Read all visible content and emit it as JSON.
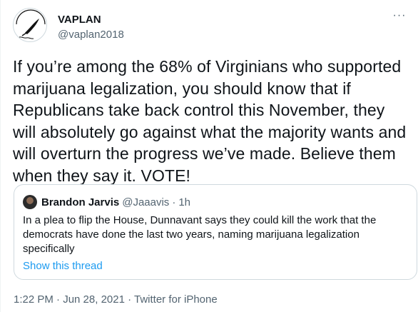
{
  "author": {
    "display_name": "VAPLAN",
    "handle": "@vaplan2018",
    "avatar_logo_text": "VAPLAN"
  },
  "tweet": {
    "text": "If you’re among the 68% of Virginians who supported marijuana legalization, you should know that if Republicans take back control this November, they will absolutely go against what the majority wants and will overturn the progress we’ve made. Believe them when they say it. VOTE!",
    "timestamp": "1:22 PM · Jun 28, 2021 · Twitter for iPhone"
  },
  "quoted_tweet": {
    "display_name": "Brandon Jarvis",
    "handle": "@Jaaavis",
    "separator": "·",
    "time": "1h",
    "text": "In a plea to flip the House, Dunnavant says they could kill the work that the democrats have done the last two years, naming marijuana legalization specifically",
    "show_thread_label": "Show this thread"
  },
  "icons": {
    "more": "more-horizontal-icon",
    "avatar": "pen-nib-logo"
  },
  "colors": {
    "link": "#1d9bf0",
    "secondary_text": "#536471",
    "primary_text": "#0f1419",
    "border": "#cfd9de"
  }
}
